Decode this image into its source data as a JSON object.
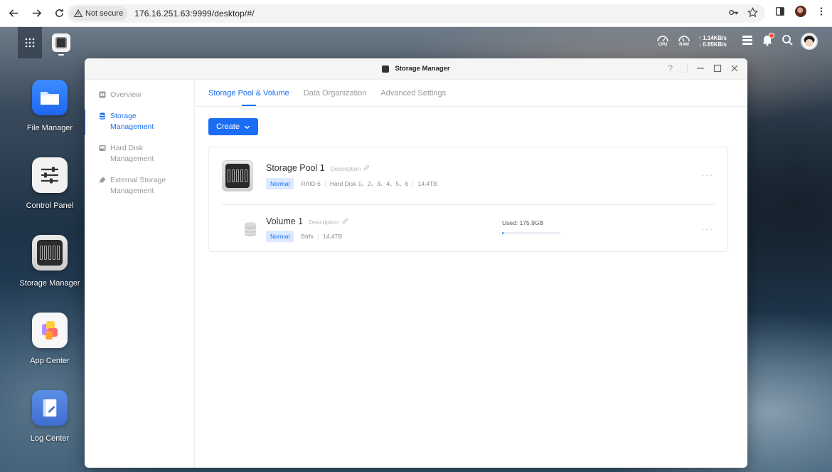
{
  "browser": {
    "security_label": "Not secure",
    "url": "176.16.251.63:9999/desktop/#/"
  },
  "taskbar": {
    "cpu_label": "CPU",
    "ram_label": "RAM",
    "upload": "↑ 1.14KB/s",
    "download": "↓ 0.85KB/s"
  },
  "desktop_icons": [
    {
      "label": "File Manager"
    },
    {
      "label": "Control Panel"
    },
    {
      "label": "Storage Manager"
    },
    {
      "label": "App Center"
    },
    {
      "label": "Log Center"
    }
  ],
  "window": {
    "title": "Storage Manager",
    "help": "?",
    "sidebar": [
      {
        "label": "Overview"
      },
      {
        "label": "Storage Management"
      },
      {
        "label": "Hard Disk Management"
      },
      {
        "label": "External Storage Management"
      }
    ],
    "tabs": [
      {
        "label": "Storage Pool & Volume"
      },
      {
        "label": "Data Organization"
      },
      {
        "label": "Advanced Settings"
      }
    ],
    "create_label": "Create",
    "pool": {
      "name": "Storage Pool 1",
      "description": "Description",
      "status": "Normal",
      "raid": "RAID 6",
      "disks": "Hard Disk 1、2、3、4、5、6",
      "capacity": "14.4TB",
      "more": "···"
    },
    "volume": {
      "name": "Volume 1",
      "description": "Description",
      "status": "Normal",
      "filesystem": "Btrfs",
      "capacity": "14.4TB",
      "used_label": "Used: 175.9GB",
      "used_fraction": 0.012,
      "more": "···"
    }
  },
  "colors": {
    "accent": "#1b6ef3",
    "badge_bg": "#dceaff"
  }
}
